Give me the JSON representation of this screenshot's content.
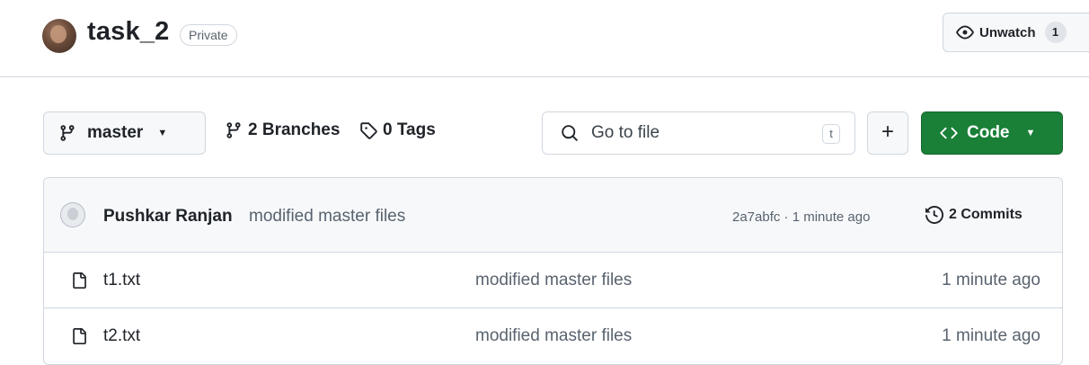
{
  "repo": {
    "name": "task_2",
    "visibility": "Private",
    "unwatch_label": "Unwatch",
    "watch_count": "1"
  },
  "toolbar": {
    "branch": "master",
    "branches_label": "2 Branches",
    "tags_label": "0 Tags",
    "search_placeholder": "Go to file",
    "search_shortcut": "t",
    "add_label": "+",
    "code_label": "Code"
  },
  "latest_commit": {
    "author": "Pushkar Ranjan",
    "message": "modified master files",
    "hash_time": "2a7abfc · 1 minute ago",
    "commits_label": "2 Commits"
  },
  "files": [
    {
      "name": "t1.txt",
      "message": "modified master files",
      "time": "1 minute ago"
    },
    {
      "name": "t2.txt",
      "message": "modified master files",
      "time": "1 minute ago"
    }
  ],
  "colors": {
    "code_button": "#1a7f37",
    "border": "#d0d7de",
    "muted_text": "#59636e"
  }
}
